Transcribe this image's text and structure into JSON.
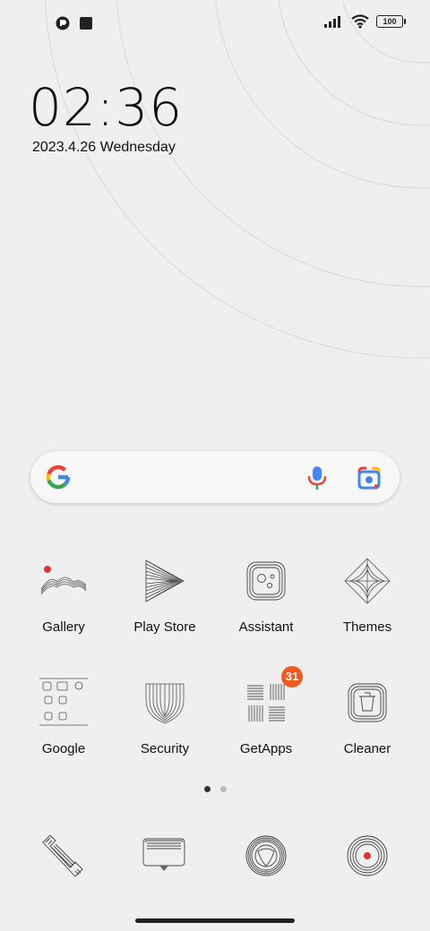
{
  "status": {
    "battery": "100"
  },
  "lockscreen": {
    "time": "02:36",
    "date": "2023.4.26 Wednesday"
  },
  "apps": [
    {
      "label": "Gallery"
    },
    {
      "label": "Play Store"
    },
    {
      "label": "Assistant"
    },
    {
      "label": "Themes"
    },
    {
      "label": "Google"
    },
    {
      "label": "Security"
    },
    {
      "label": "GetApps",
      "badge": "31"
    },
    {
      "label": "Cleaner"
    }
  ],
  "dock": [
    "phone-icon",
    "messages-icon",
    "browser-icon",
    "camera-icon"
  ],
  "colors": {
    "background": "#efefef",
    "badge": "#f05a22",
    "google_blue": "#4285F4",
    "google_red": "#EA4335",
    "google_yellow": "#FBBC05",
    "google_green": "#34A853"
  }
}
